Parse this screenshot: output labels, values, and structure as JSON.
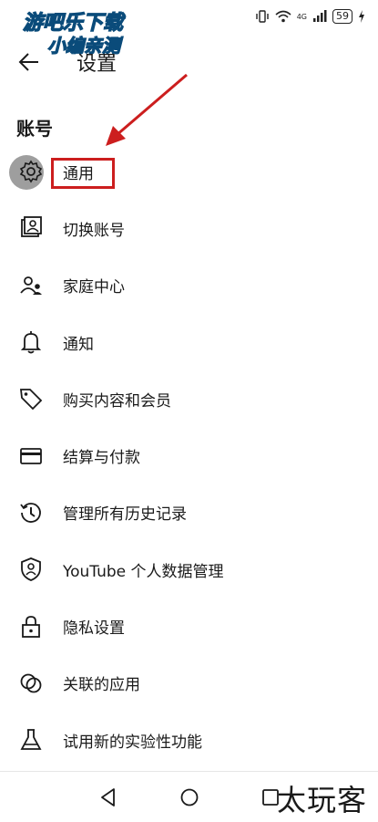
{
  "status_bar": {
    "signal_label": "4G",
    "battery": "59",
    "watermark_line1": "游吧乐下载",
    "watermark_line2": "小编亲测"
  },
  "header": {
    "title": "设置",
    "back_icon": "arrow-left-icon"
  },
  "section": {
    "title": "账号"
  },
  "menu": [
    {
      "label": "通用",
      "icon": "gear-icon"
    },
    {
      "label": "切换账号",
      "icon": "switch-account-icon"
    },
    {
      "label": "家庭中心",
      "icon": "family-icon"
    },
    {
      "label": "通知",
      "icon": "bell-icon"
    },
    {
      "label": "购买内容和会员",
      "icon": "tag-icon"
    },
    {
      "label": "结算与付款",
      "icon": "credit-card-icon"
    },
    {
      "label": "管理所有历史记录",
      "icon": "history-icon"
    },
    {
      "label": "YouTube 个人数据管理",
      "icon": "shield-person-icon"
    },
    {
      "label": "隐私设置",
      "icon": "lock-icon"
    },
    {
      "label": "关联的应用",
      "icon": "linked-circles-icon"
    },
    {
      "label": "试用新的实验性功能",
      "icon": "flask-icon"
    }
  ],
  "nav_bar": {
    "back_icon": "triangle-back-icon",
    "home_icon": "circle-home-icon",
    "recents_icon": "square-recents-icon"
  },
  "brand_text": "太玩客",
  "colors": {
    "highlight": "#cc1e1e",
    "watermark_fill": "#2fb4f0"
  }
}
